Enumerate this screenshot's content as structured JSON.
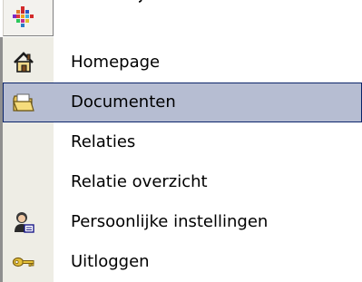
{
  "menubar": {
    "logo_icon": "app-logo-icon"
  },
  "menu": {
    "selected_index": 1,
    "selection_color": "#b6bdd2",
    "gutter_color": "#eeede5",
    "items": [
      {
        "label": "Homepage",
        "icon": "home-icon"
      },
      {
        "label": "Documenten",
        "icon": "open-folder-icon"
      },
      {
        "label": "Relaties",
        "icon": ""
      },
      {
        "label": "Relatie overzicht",
        "icon": ""
      },
      {
        "label": "Persoonlijke instellingen",
        "icon": "user-settings-icon"
      },
      {
        "label": "Uitloggen",
        "icon": "key-icon"
      }
    ]
  }
}
